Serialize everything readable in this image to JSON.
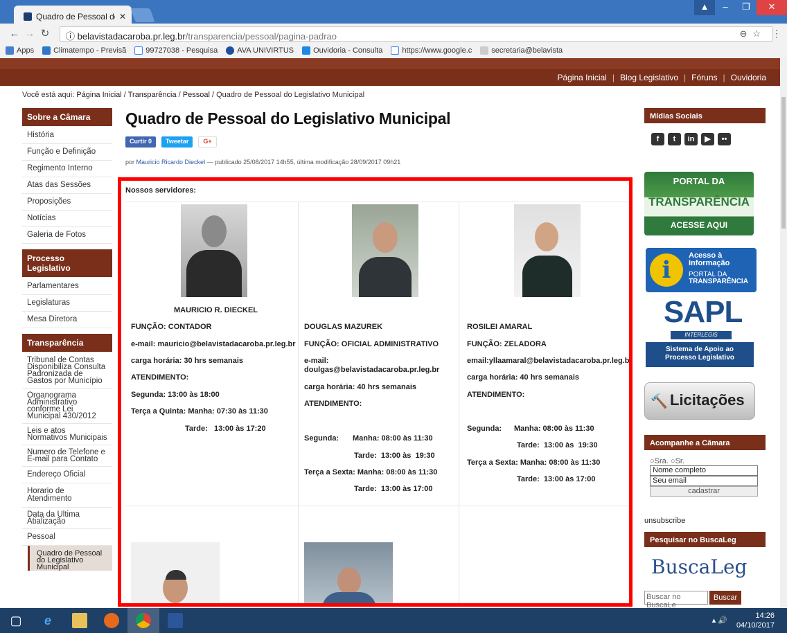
{
  "browser": {
    "tab_title": "Quadro de Pessoal do Le",
    "url_host": "belavistadacaroba.pr.leg.br",
    "url_path": "/transparencia/pessoal/pagina-padrao",
    "bookmarks": [
      "Apps",
      "Climatempo - Previsã",
      "99727038 - Pesquisa",
      "AVA UNIVIRTUS",
      "Ouvidoria - Consulta",
      "https://www.google.c",
      "secretaria@belavista"
    ]
  },
  "topnav": [
    "Página Inicial",
    "Blog Legislativo",
    "Fóruns",
    "Ouvidoria"
  ],
  "breadcrumb": {
    "prefix": "Você está aqui:",
    "items": [
      "Página Inicial",
      "Transparência",
      "Pessoal"
    ],
    "current": "Quadro de Pessoal do Legislativo Municipal"
  },
  "leftnav": {
    "sobre": {
      "title": "Sobre a Câmara",
      "items": [
        "História",
        "Função e Definição",
        "Regimento Interno",
        "Atas das Sessões",
        "Proposições",
        "Notícias",
        "Galeria de Fotos"
      ]
    },
    "processo": {
      "title": "Processo Legislativo",
      "items": [
        "Parlamentares",
        "Legislaturas",
        "Mesa Diretora"
      ]
    },
    "transparencia": {
      "title": "Transparência",
      "items": [
        "Tribunal de Contas Disponibiliza Consulta Padronizada de Gastos por Município",
        "Organograma Administrativo conforme Lei Municipal 430/2012",
        "Leis e atos Normativos Municipais",
        "Numero de Telefone e E-mail para Contato",
        "Endereço Oficial",
        "Horario de Atendimento",
        "Data da Ultima Atialização",
        "Pessoal"
      ]
    },
    "subitem": "Quadro de Pessoal do Legislativo Municipal"
  },
  "main": {
    "title": "Quadro de Pessoal do Legislativo Municipal",
    "share": {
      "like": "Curtir 0",
      "tweet": "Tweetar",
      "gplus": "G+"
    },
    "byline": {
      "pre": "por",
      "author": "Mauricio Ricardo Dieckel",
      "rest": "— publicado 25/08/2017 14h55, última modificação 28/09/2017 09h21"
    },
    "staff_label": "Nossos servidores:",
    "staff": [
      {
        "name": "MAURICIO R. DIECKEL",
        "funcao": "FUNÇÃO: CONTADOR",
        "email": "e-mail: mauricio@belavistadacaroba.pr.leg.br",
        "carga": "carga horária: 30 hrs semanais",
        "atend": "ATENDIMENTO:",
        "h1": "Segunda: 13:00 às 18:00",
        "h2": "Terça a Quinta: Manha: 07:30 às 11:30",
        "h3": "Tarde:   13:00 às 17:20"
      },
      {
        "name": "DOUGLAS MAZUREK",
        "funcao": "FUNÇÃO: OFICIAL ADMINISTRATIVO",
        "email1": "e-mail:",
        "email2": "doulgas@belavistadacaroba.pr.leg.br",
        "carga": "carga horária: 40 hrs semanais",
        "atend": "ATENDIMENTO:",
        "h1a": "Segunda:",
        "h1b": "Manha: 08:00 às 11:30",
        "h2": "Tarde:  13:00 às  19:30",
        "h3": "Terça a Sexta: Manha: 08:00 às 11:30",
        "h4": "Tarde:  13:00 às 17:00"
      },
      {
        "name": "ROSILEI AMARAL",
        "funcao": "FUNÇÃO: ZELADORA",
        "email": "email:yllaamaral@belavistadacaroba.pr.leg.br",
        "carga": "carga horária: 40 hrs semanais",
        "atend": "ATENDIMENTO:",
        "h1a": "Segunda:",
        "h1b": "Manha: 08:00 às 11:30",
        "h2": "Tarde:  13:00 às  19:30",
        "h3": "Terça a Sexta: Manha: 08:00 às 11:30",
        "h4": "Tarde:  13:00 às 17:00"
      }
    ]
  },
  "right": {
    "midias_title": "Mídias Sociais",
    "social_icons": [
      "facebook-icon",
      "twitter-icon",
      "linkedin-icon",
      "youtube-icon",
      "flickr-icon"
    ],
    "portal": {
      "l1": "PORTAL DA",
      "l2": "TRANSPARÊNCIA",
      "l3": "ACESSE AQUI"
    },
    "acesso": {
      "l1": "Acesso à",
      "l2": "Informação",
      "l3": "PORTAL DA",
      "l4": "TRANSPARÊNCIA"
    },
    "sapl": {
      "l1": "SAPL",
      "l2": "INTERLEGIS",
      "l3": "Sistema de Apoio ao",
      "l4": "Processo Legislativo"
    },
    "licit": "Licitações",
    "acomp_title": "Acompanhe a Câmara",
    "sra": "Sra.",
    "sr": "Sr.",
    "nome_ph": "Nome completo",
    "email_ph": "Seu email",
    "cadastrar": "cadastrar",
    "unsubscribe": "unsubscribe",
    "buscaleg_title": "Pesquisar no BuscaLeg",
    "buscaleg_logo": "BuscaLeg",
    "busca_ph": "Buscar no BuscaLe",
    "busca_btn": "Buscar"
  },
  "taskbar": {
    "time": "14:26",
    "date": "04/10/2017"
  }
}
